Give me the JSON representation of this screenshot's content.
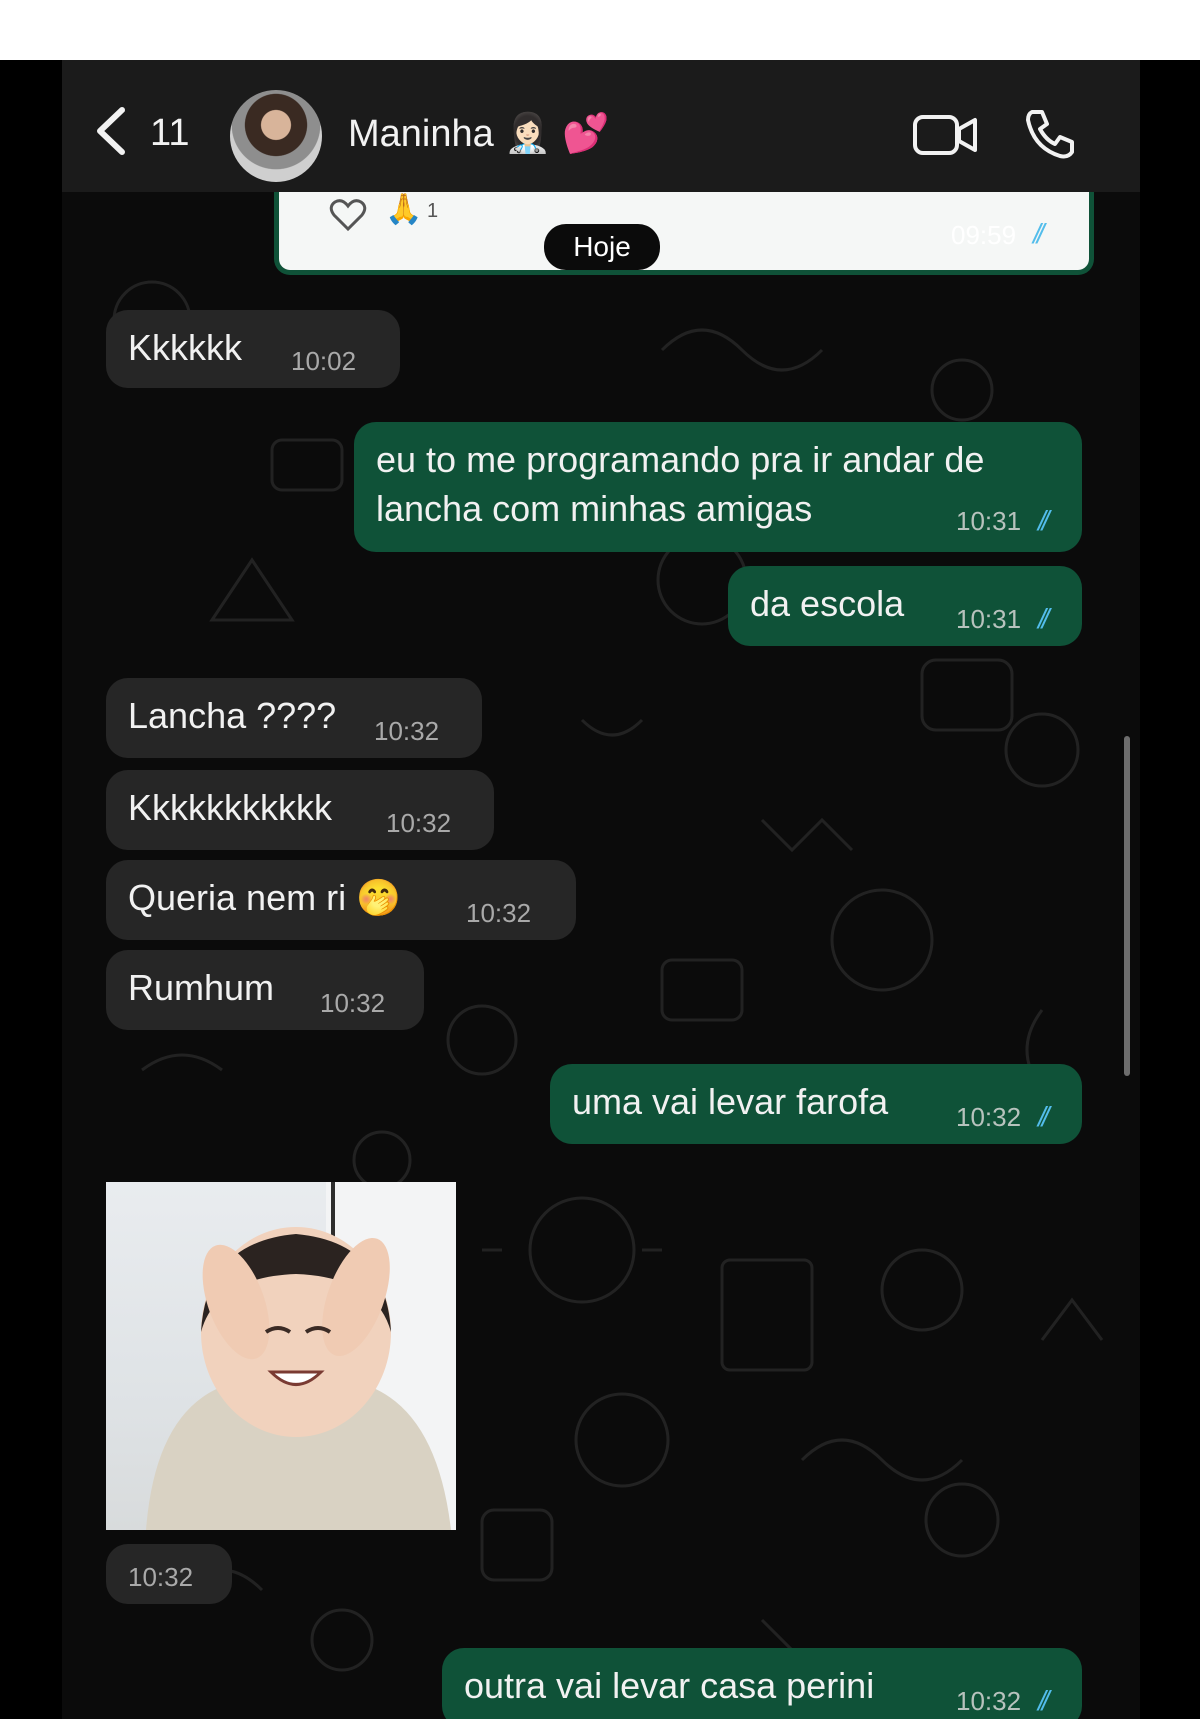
{
  "header": {
    "unread_count": "11",
    "contact_name": "Maninha 👩🏻‍⚕️ 💕"
  },
  "pinned_preview": {
    "reaction_count": "1",
    "time": "09:59"
  },
  "date_chip": "Hoje",
  "messages": [
    {
      "direction": "in",
      "text": "Kkkkkk",
      "time": "10:02"
    },
    {
      "direction": "out",
      "line1": "eu to me programando pra ir andar de",
      "line2": "lancha com minhas amigas",
      "time": "10:31",
      "status": "read"
    },
    {
      "direction": "out",
      "text": "da escola",
      "time": "10:31",
      "status": "read"
    },
    {
      "direction": "in",
      "text": "Lancha ????",
      "time": "10:32"
    },
    {
      "direction": "in",
      "text": "Kkkkkkkkkkk",
      "time": "10:32"
    },
    {
      "direction": "in",
      "text": "Queria nem ri 🤭",
      "time": "10:32"
    },
    {
      "direction": "in",
      "text": "Rumhum",
      "time": "10:32"
    },
    {
      "direction": "out",
      "text": "uma vai levar farofa",
      "time": "10:32",
      "status": "read"
    },
    {
      "direction": "in",
      "type": "sticker",
      "time": "10:32"
    },
    {
      "direction": "out",
      "text": "outra vai levar casa perini",
      "time": "10:32",
      "status": "read"
    }
  ],
  "colors": {
    "incoming_bubble": "#262626",
    "outgoing_bubble": "#0f5238",
    "read_ticks": "#53bdeb",
    "chat_background": "#0b0b0b"
  },
  "icons": [
    "back-chevron-icon",
    "video-call-icon",
    "voice-call-icon",
    "heart-icon",
    "pray-emoji-icon",
    "double-check-icon"
  ]
}
